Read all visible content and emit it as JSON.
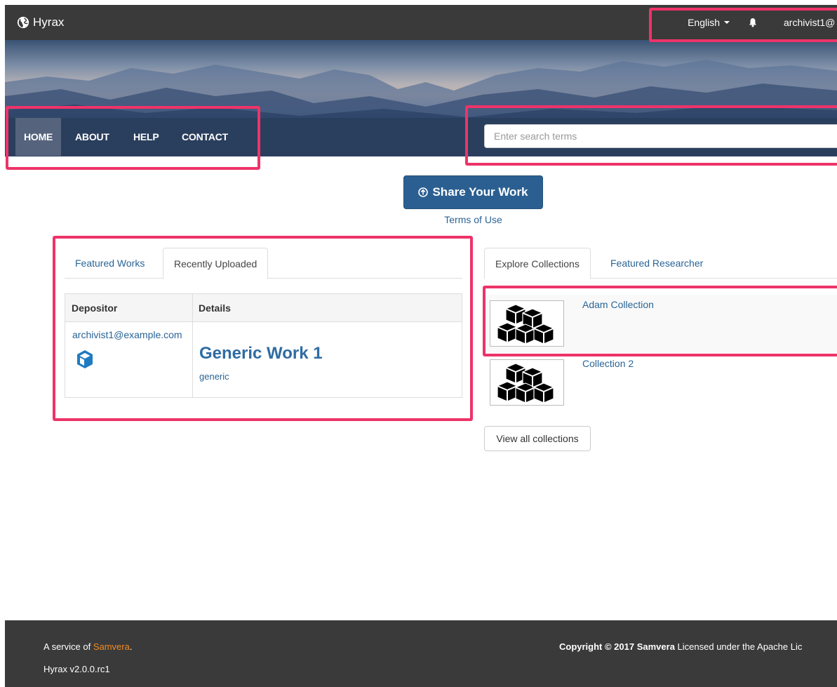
{
  "header": {
    "brand": "Hyrax",
    "language": "English",
    "user": "archivist1@"
  },
  "nav": {
    "items": [
      {
        "label": "HOME",
        "active": true
      },
      {
        "label": "ABOUT",
        "active": false
      },
      {
        "label": "HELP",
        "active": false
      },
      {
        "label": "CONTACT",
        "active": false
      }
    ]
  },
  "search": {
    "placeholder": "Enter search terms"
  },
  "share": {
    "button_label": "Share Your Work",
    "terms_link": "Terms of Use"
  },
  "works_panel": {
    "tabs": [
      {
        "label": "Featured Works",
        "active": false
      },
      {
        "label": "Recently Uploaded",
        "active": true
      }
    ],
    "columns": [
      "Depositor",
      "Details"
    ],
    "rows": [
      {
        "depositor": "archivist1@example.com",
        "title": "Generic Work 1",
        "type": "generic"
      }
    ]
  },
  "collections_panel": {
    "tabs": [
      {
        "label": "Explore Collections",
        "active": true
      },
      {
        "label": "Featured Researcher",
        "active": false
      }
    ],
    "items": [
      {
        "name": "Adam Collection"
      },
      {
        "name": "Collection 2"
      }
    ],
    "view_all_label": "View all collections"
  },
  "footer": {
    "service_prefix": "A service of",
    "service_link": "Samvera",
    "service_suffix": ".",
    "version": "Hyrax v2.0.0.rc1",
    "copyright_bold": "Copyright © 2017 Samvera",
    "copyright_rest": " Licensed under the Apache Lic"
  },
  "colors": {
    "annotation": "#ee3369",
    "primary": "#2b5f91",
    "link": "#2a6496",
    "navbar": "#3a3a3a",
    "footer_link": "#f08a24"
  }
}
